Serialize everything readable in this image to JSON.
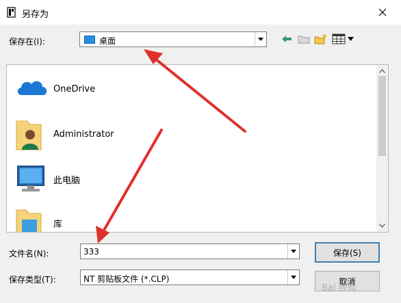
{
  "window": {
    "title": "另存为"
  },
  "save_in": {
    "label": "保存在(I):",
    "value": "桌面"
  },
  "toolbar": {
    "icons": [
      "back-icon",
      "up-folder-icon",
      "new-folder-icon",
      "view-menu-icon"
    ]
  },
  "files": [
    {
      "name": "OneDrive",
      "icon": "onedrive-icon"
    },
    {
      "name": "Administrator",
      "icon": "user-folder-icon"
    },
    {
      "name": "此电脑",
      "icon": "this-pc-icon"
    },
    {
      "name": "库",
      "icon": "library-icon"
    }
  ],
  "filename": {
    "label": "文件名(N):",
    "value": "333"
  },
  "filetype": {
    "label": "保存类型(T):",
    "value": "NT 剪贴板文件 (*.CLP)"
  },
  "buttons": {
    "save": "保存(S)",
    "cancel": "取消"
  },
  "watermark": "Bai 经验",
  "colors": {
    "annotation_arrow": "#e0302a",
    "default_button_border": "#3c7fb1"
  }
}
